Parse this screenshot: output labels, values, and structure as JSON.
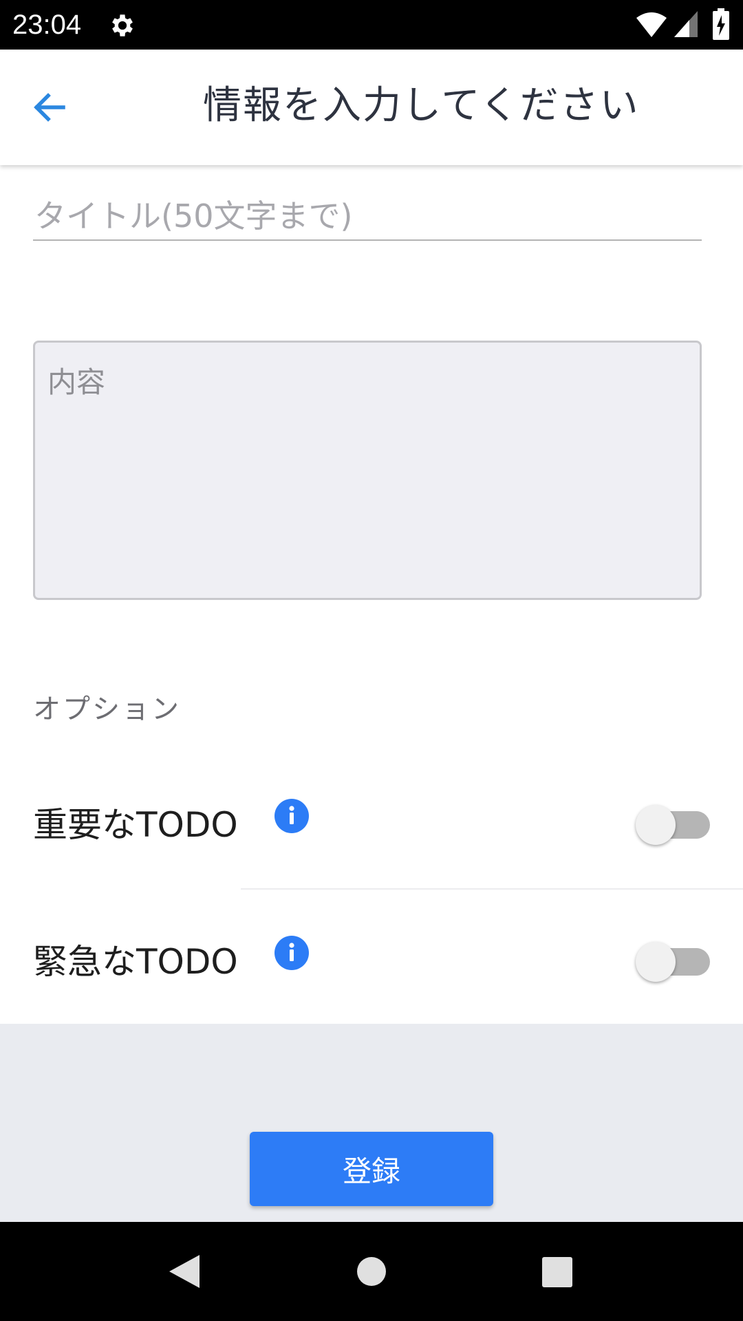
{
  "status_bar": {
    "time": "23:04",
    "icons": [
      "gear-icon",
      "wifi-icon",
      "cellular-signal-icon",
      "battery-charging-icon"
    ]
  },
  "app_bar": {
    "back_icon": "arrow-left-icon",
    "title": "情報を入力してください"
  },
  "form": {
    "title_placeholder": "タイトル(50文字まで)",
    "title_value": "",
    "content_placeholder": "内容",
    "content_value": ""
  },
  "options": {
    "section_label": "オプション",
    "items": [
      {
        "label": "重要なTODO",
        "info_icon": "info-icon",
        "enabled": false
      },
      {
        "label": "緊急なTODO",
        "info_icon": "info-icon",
        "enabled": false
      }
    ]
  },
  "footer": {
    "register_label": "登録"
  },
  "nav_bar": {
    "icons": [
      "nav-back-icon",
      "nav-home-icon",
      "nav-recents-icon"
    ]
  },
  "colors": {
    "accent": "#2d7cf6",
    "back_arrow": "#2b87e0",
    "title_text": "#2e3340",
    "content_bg": "#efeff4",
    "footer_bg": "#e9ebf0"
  }
}
